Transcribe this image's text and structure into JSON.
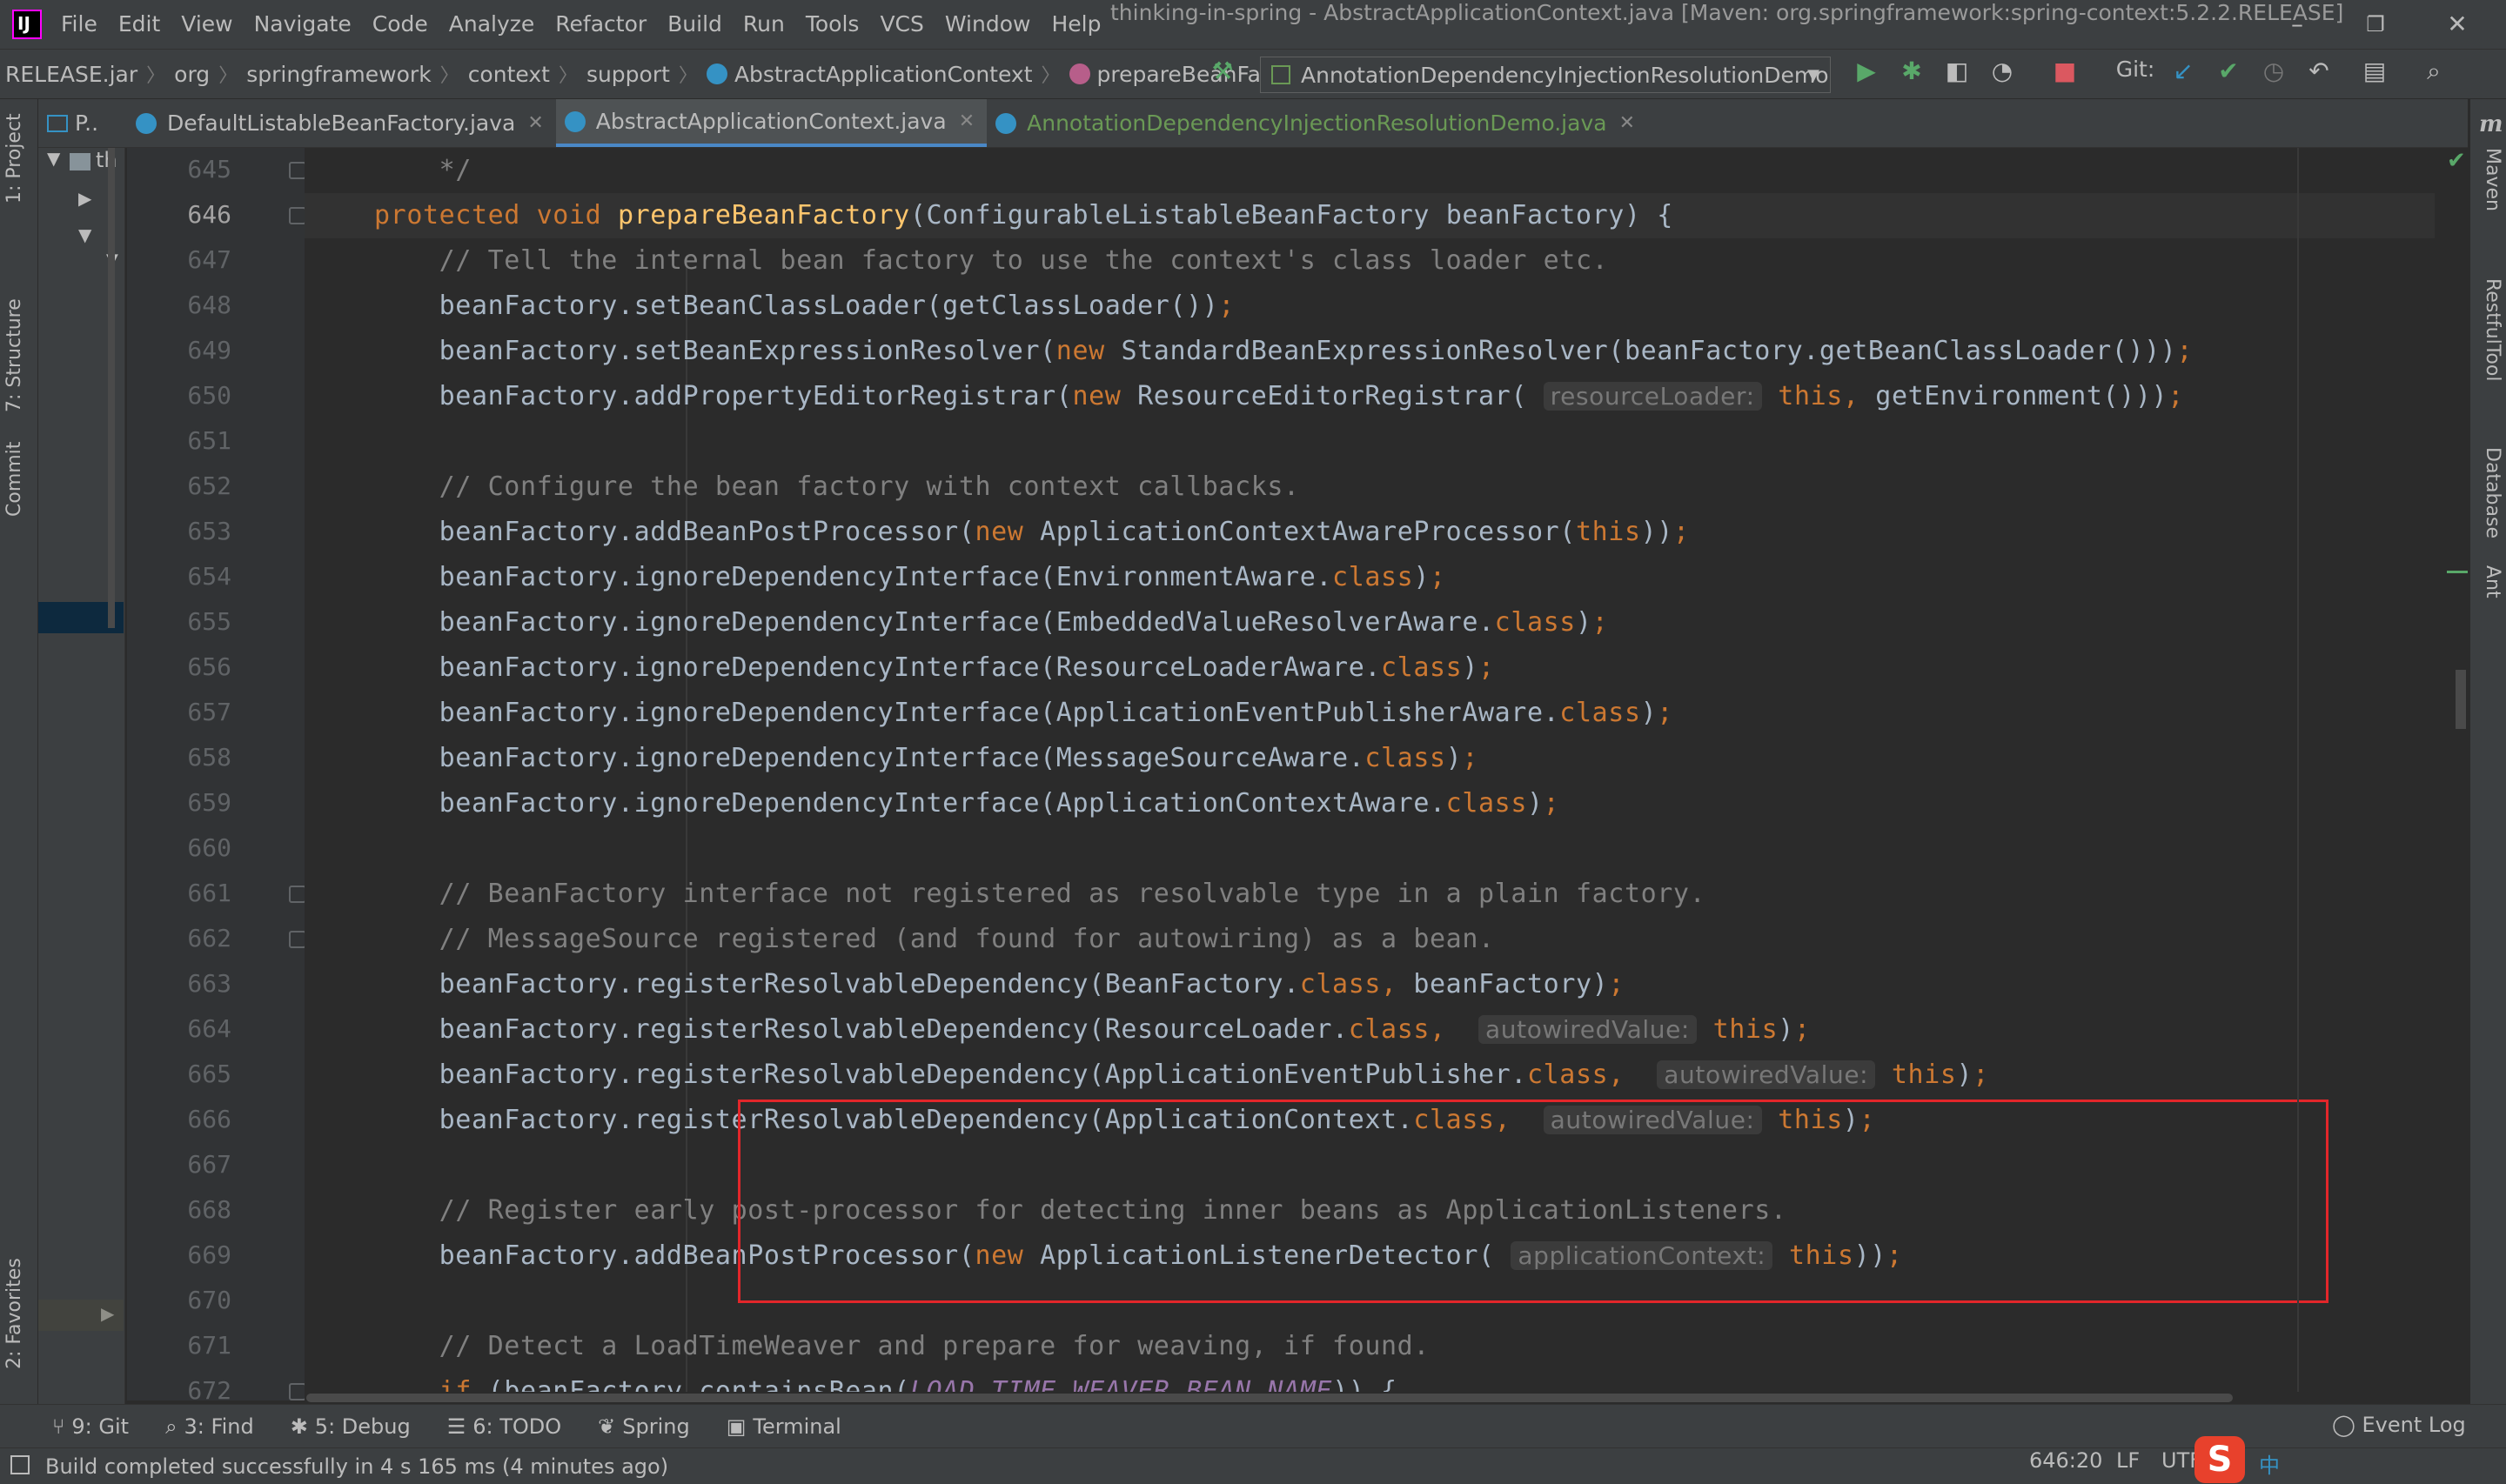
{
  "app": {
    "window_title": "thinking-in-spring - AbstractApplicationContext.java [Maven: org.springframework:spring-context:5.2.2.RELEASE]",
    "logo_text": "IJ"
  },
  "menu": [
    "File",
    "Edit",
    "View",
    "Navigate",
    "Code",
    "Analyze",
    "Refactor",
    "Build",
    "Run",
    "Tools",
    "VCS",
    "Window",
    "Help"
  ],
  "breadcrumb": {
    "items": [
      "RELEASE.jar",
      "org",
      "springframework",
      "context",
      "support",
      "AbstractApplicationContext",
      "prepareBeanFactory"
    ]
  },
  "toolbar": {
    "run_config": "AnnotationDependencyInjectionResolutionDemo",
    "git_label": "Git:"
  },
  "tabs": [
    {
      "label": "DefaultListableBeanFactory.java",
      "active": false
    },
    {
      "label": "AbstractApplicationContext.java",
      "active": true
    },
    {
      "label": "AnnotationDependencyInjectionResolutionDemo.java",
      "active": false
    }
  ],
  "project_panel": {
    "title": "P..",
    "root_label": "th"
  },
  "left_tools": [
    "1: Project",
    "7: Structure",
    "Commit",
    "2: Favorites"
  ],
  "right_tools": [
    "Maven",
    "RestfulTool",
    "Database",
    "Ant"
  ],
  "editor": {
    "current_line": 646,
    "lines": [
      {
        "no": 645,
        "html": "    <span class=\"cm\">*/</span>"
      },
      {
        "no": 646,
        "html": "<span class=\"kw\">protected void </span><span class=\"fn\">prepareBeanFactory</span>(ConfigurableListableBeanFactory beanFactory) {"
      },
      {
        "no": 647,
        "html": "    <span class=\"cm\">// Tell the internal bean factory to use the context's class loader etc.</span>"
      },
      {
        "no": 648,
        "html": "    beanFactory.setBeanClassLoader(getClassLoader())<span class=\"kw\">;</span>"
      },
      {
        "no": 649,
        "html": "    beanFactory.setBeanExpressionResolver(<span class=\"kw\">new </span>StandardBeanExpressionResolver(beanFactory.getBeanClassLoader()))<span class=\"kw\">;</span>"
      },
      {
        "no": 650,
        "html": "    beanFactory.addPropertyEditorRegistrar(<span class=\"kw\">new </span>ResourceEditorRegistrar( <span class=\"hint\">resourceLoader:</span> <span class=\"kw\">this, </span>getEnvironment()))<span class=\"kw\">;</span>"
      },
      {
        "no": 651,
        "html": ""
      },
      {
        "no": 652,
        "html": "    <span class=\"cm\">// Configure the bean factory with context callbacks.</span>"
      },
      {
        "no": 653,
        "html": "    beanFactory.addBeanPostProcessor(<span class=\"kw\">new </span>ApplicationContextAwareProcessor(<span class=\"kw\">this</span>))<span class=\"kw\">;</span>"
      },
      {
        "no": 654,
        "html": "    beanFactory.ignoreDependencyInterface(EnvironmentAware.<span class=\"kw\">class</span>)<span class=\"kw\">;</span>"
      },
      {
        "no": 655,
        "html": "    beanFactory.ignoreDependencyInterface(EmbeddedValueResolverAware.<span class=\"kw\">class</span>)<span class=\"kw\">;</span>"
      },
      {
        "no": 656,
        "html": "    beanFactory.ignoreDependencyInterface(ResourceLoaderAware.<span class=\"kw\">class</span>)<span class=\"kw\">;</span>"
      },
      {
        "no": 657,
        "html": "    beanFactory.ignoreDependencyInterface(ApplicationEventPublisherAware.<span class=\"kw\">class</span>)<span class=\"kw\">;</span>"
      },
      {
        "no": 658,
        "html": "    beanFactory.ignoreDependencyInterface(MessageSourceAware.<span class=\"kw\">class</span>)<span class=\"kw\">;</span>"
      },
      {
        "no": 659,
        "html": "    beanFactory.ignoreDependencyInterface(ApplicationContextAware.<span class=\"kw\">class</span>)<span class=\"kw\">;</span>"
      },
      {
        "no": 660,
        "html": ""
      },
      {
        "no": 661,
        "html": "    <span class=\"cm\">// BeanFactory interface not registered as resolvable type in a plain factory.</span>"
      },
      {
        "no": 662,
        "html": "    <span class=\"cm\">// MessageSource registered (and found for autowiring) as a bean.</span>"
      },
      {
        "no": 663,
        "html": "    beanFactory.registerResolvableDependency(BeanFactory.<span class=\"kw\">class, </span>beanFactory)<span class=\"kw\">;</span>"
      },
      {
        "no": 664,
        "html": "    beanFactory.registerResolvableDependency(ResourceLoader.<span class=\"kw\">class, </span> <span class=\"hint\">autowiredValue:</span> <span class=\"kw\">this</span>)<span class=\"kw\">;</span>"
      },
      {
        "no": 665,
        "html": "    beanFactory.registerResolvableDependency(ApplicationEventPublisher.<span class=\"kw\">class, </span> <span class=\"hint\">autowiredValue:</span> <span class=\"kw\">this</span>)<span class=\"kw\">;</span>"
      },
      {
        "no": 666,
        "html": "    beanFactory.registerResolvableDependency(ApplicationContext.<span class=\"kw\">class, </span> <span class=\"hint\">autowiredValue:</span> <span class=\"kw\">this</span>)<span class=\"kw\">;</span>"
      },
      {
        "no": 667,
        "html": ""
      },
      {
        "no": 668,
        "html": "    <span class=\"cm\">// Register early post-processor for detecting inner beans as ApplicationListeners.</span>"
      },
      {
        "no": 669,
        "html": "    beanFactory.addBeanPostProcessor(<span class=\"kw\">new </span>ApplicationListenerDetector( <span class=\"hint\">applicationContext:</span> <span class=\"kw\">this</span>))<span class=\"kw\">;</span>"
      },
      {
        "no": 670,
        "html": ""
      },
      {
        "no": 671,
        "html": "    <span class=\"cm\">// Detect a LoadTimeWeaver and prepare for weaving, if found.</span>"
      },
      {
        "no": 672,
        "html": "    <span class=\"kw\">if </span>(beanFactory.containsBean(<span class=\"cst\">LOAD_TIME_WEAVER_BEAN_NAME</span>)) {"
      }
    ]
  },
  "bottom_tools": [
    {
      "icon": "⑂",
      "label": "9: Git"
    },
    {
      "icon": "⌕",
      "label": "3: Find"
    },
    {
      "icon": "✱",
      "label": "5: Debug"
    },
    {
      "icon": "☰",
      "label": "6: TODO"
    },
    {
      "icon": "❦",
      "label": "Spring"
    },
    {
      "icon": "▣",
      "label": "Terminal"
    }
  ],
  "event_log": "Event Log",
  "status": {
    "message": "Build completed successfully in 4 s 165 ms (4 minutes ago)",
    "position": "646:20",
    "line_sep": "LF",
    "encoding": "UTF",
    "ime": "中"
  },
  "colors": {
    "keyword": "#cc7832",
    "function": "#ffc66d",
    "comment": "#808080",
    "highlight_box": "#e3262a",
    "active_tab_underline": "#4a88c7"
  }
}
